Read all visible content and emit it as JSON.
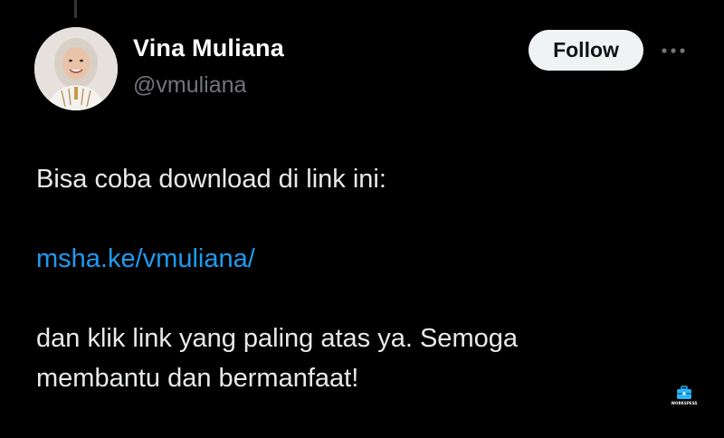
{
  "author": {
    "name": "Vina Muliana",
    "handle": "@vmuliana",
    "avatar_icon": "user-avatar-photo"
  },
  "header": {
    "follow_label": "Follow",
    "more_icon": "more-horizontal-icon"
  },
  "tweet": {
    "line_1": "Bisa coba download di link ini:",
    "link_text": "msha.ke/vmuliana/",
    "line_3a": "dan klik link yang paling atas ya. Semoga",
    "line_3b": "membantu dan bermanfaat!"
  },
  "watermark": {
    "text": "WORKSPESS",
    "icon": "briefcase-icon"
  },
  "colors": {
    "background": "#000000",
    "link": "#1d9bf0",
    "secondary_text": "#71767b",
    "follow_button_bg": "#eff3f4"
  }
}
